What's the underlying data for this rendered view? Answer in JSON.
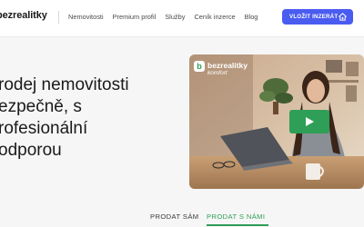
{
  "header": {
    "logo_text": "bezrealitky",
    "nav": [
      "Nemovitosti",
      "Premium profil",
      "Služby",
      "Ceník inzerce",
      "Blog"
    ],
    "cta_label": "VLOŽIT INZERÁT"
  },
  "hero": {
    "lines": [
      "rodej nemovitosti",
      "ezpečně, s",
      "rofesionální",
      "odporou"
    ]
  },
  "video": {
    "badge_brand": "bezrealitky",
    "badge_sub": "komfort"
  },
  "tabs": {
    "tab1": "PRODAT SÁM",
    "tab2": "PRODAT S NÁMI"
  },
  "colors": {
    "accent_blue": "#4a5cf0",
    "accent_green": "#2f9e56"
  }
}
